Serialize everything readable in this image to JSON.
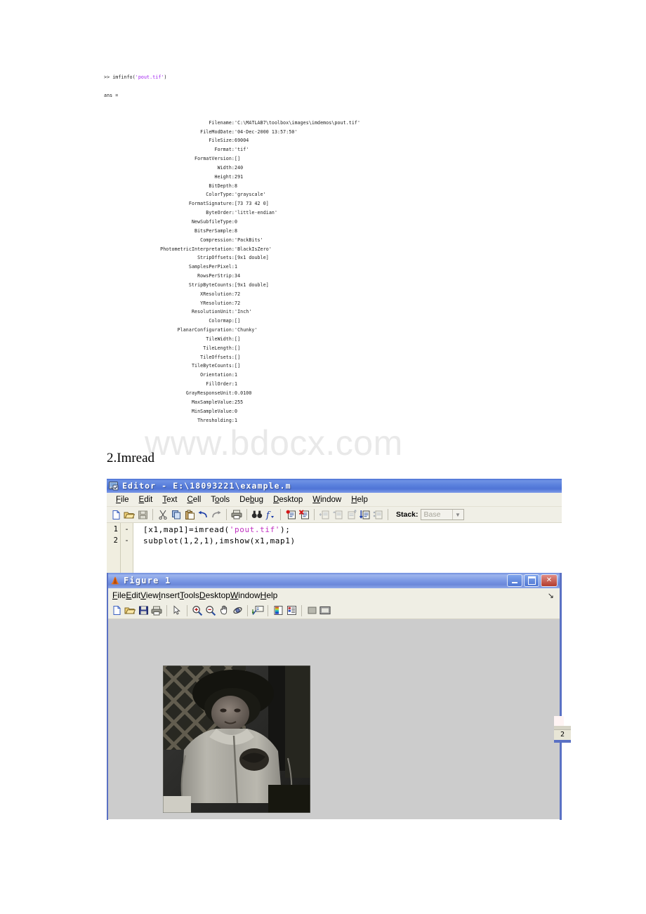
{
  "console": {
    "prompt": ">> ",
    "command_pre": "imfinfo(",
    "command_arg": "'pout.tif'",
    "command_post": ")",
    "ans": "ans =",
    "fields": [
      {
        "name": "Filename:",
        "value": "'C:\\MATLAB7\\toolbox\\images\\imdemos\\pout.tif'"
      },
      {
        "name": "FileModDate:",
        "value": "'04-Dec-2000 13:57:50'"
      },
      {
        "name": "FileSize:",
        "value": "69004"
      },
      {
        "name": "Format:",
        "value": "'tif'"
      },
      {
        "name": "FormatVersion:",
        "value": "[]"
      },
      {
        "name": "Width:",
        "value": "240"
      },
      {
        "name": "Height:",
        "value": "291"
      },
      {
        "name": "BitDepth:",
        "value": "8"
      },
      {
        "name": "ColorType:",
        "value": "'grayscale'"
      },
      {
        "name": "FormatSignature:",
        "value": "[73 73 42 0]"
      },
      {
        "name": "ByteOrder:",
        "value": "'little-endian'"
      },
      {
        "name": "NewSubfileType:",
        "value": "0"
      },
      {
        "name": "BitsPerSample:",
        "value": "8"
      },
      {
        "name": "Compression:",
        "value": "'PackBits'"
      },
      {
        "name": "PhotometricInterpretation:",
        "value": "'BlackIsZero'"
      },
      {
        "name": "StripOffsets:",
        "value": "[9x1 double]"
      },
      {
        "name": "SamplesPerPixel:",
        "value": "1"
      },
      {
        "name": "RowsPerStrip:",
        "value": "34"
      },
      {
        "name": "StripByteCounts:",
        "value": "[9x1 double]"
      },
      {
        "name": "XResolution:",
        "value": "72"
      },
      {
        "name": "YResolution:",
        "value": "72"
      },
      {
        "name": "ResolutionUnit:",
        "value": "'Inch'"
      },
      {
        "name": "Colormap:",
        "value": "[]"
      },
      {
        "name": "PlanarConfiguration:",
        "value": "'Chunky'"
      },
      {
        "name": "TileWidth:",
        "value": "[]"
      },
      {
        "name": "TileLength:",
        "value": "[]"
      },
      {
        "name": "TileOffsets:",
        "value": "[]"
      },
      {
        "name": "TileByteCounts:",
        "value": "[]"
      },
      {
        "name": "Orientation:",
        "value": "1"
      },
      {
        "name": "FillOrder:",
        "value": "1"
      },
      {
        "name": "GrayResponseUnit:",
        "value": "0.0100"
      },
      {
        "name": "MaxSampleValue:",
        "value": "255"
      },
      {
        "name": "MinSampleValue:",
        "value": "0"
      },
      {
        "name": "Thresholding:",
        "value": "1"
      }
    ]
  },
  "watermark": {
    "text": "www.bdocx.com"
  },
  "heading": {
    "text": "2.Imread"
  },
  "editor": {
    "title": "Editor - E:\\18093221\\example.m",
    "title_icon": "matlab-editor-icon",
    "menu": [
      {
        "label": "File",
        "accel": "F"
      },
      {
        "label": "Edit",
        "accel": "E"
      },
      {
        "label": "Text",
        "accel": "T"
      },
      {
        "label": "Cell",
        "accel": "C"
      },
      {
        "label": "Tools",
        "accel": "o"
      },
      {
        "label": "Debug",
        "accel": "b"
      },
      {
        "label": "Desktop",
        "accel": "D"
      },
      {
        "label": "Window",
        "accel": "W"
      },
      {
        "label": "Help",
        "accel": "H"
      }
    ],
    "toolbar_icons": [
      "new-file-icon",
      "open-folder-icon",
      "save-icon",
      "sep",
      "cut-scissors-icon",
      "copy-icon",
      "paste-icon",
      "undo-arrow-icon",
      "redo-arrow-icon",
      "sep",
      "print-icon",
      "sep",
      "find-binoculars-icon",
      "function-browser-icon",
      "sep",
      "set-breakpoint-icon",
      "clear-breakpoints-icon",
      "sep",
      "step-in-icon",
      "step-icon",
      "step-out-icon",
      "continue-icon",
      "exit-debug-icon"
    ],
    "stack_label": "Stack:",
    "stack_value": "Base",
    "code": [
      {
        "num": "1",
        "dash": "-",
        "pre": "[x1,map1]=imread(",
        "str": "'pout.tif'",
        "post": ");"
      },
      {
        "num": "2",
        "dash": "-",
        "pre": "subplot(1,2,1),imshow(x1,map1)",
        "str": "",
        "post": ""
      }
    ]
  },
  "figure": {
    "title": "Figure 1",
    "title_icon": "matlab-membrane-icon",
    "menu": [
      {
        "label": "File",
        "accel": "F"
      },
      {
        "label": "Edit",
        "accel": "E"
      },
      {
        "label": "View",
        "accel": "V"
      },
      {
        "label": "Insert",
        "accel": "I"
      },
      {
        "label": "Tools",
        "accel": "T"
      },
      {
        "label": "Desktop",
        "accel": "D"
      },
      {
        "label": "Window",
        "accel": "W"
      },
      {
        "label": "Help",
        "accel": "H"
      }
    ],
    "overflow_glyph": "↘",
    "toolbar_icons": [
      "new-figure-icon",
      "open-folder-icon",
      "save-icon",
      "print-icon",
      "sep",
      "pointer-arrow-icon",
      "sep",
      "zoom-in-icon",
      "zoom-out-icon",
      "pan-hand-icon",
      "rotate-3d-icon",
      "sep",
      "insert-legend-icon",
      "sep",
      "insert-colorbar-icon",
      "plot-browser-icon",
      "sep",
      "hide-plot-tools-icon",
      "show-plot-tools-icon"
    ],
    "window_buttons": [
      {
        "name": "minimize",
        "glyph": "_"
      },
      {
        "name": "maximize",
        "glyph": "□"
      },
      {
        "name": "close",
        "glyph": "✕"
      }
    ],
    "image_alt": "pout.tif grayscale photo of a child in a jacket"
  },
  "background_window": {
    "cell_text": "2"
  },
  "colors": {
    "titlebar_blue": "#4f74d6",
    "figure_titlebar_blue": "#7d9ae5",
    "toolbar_bg": "#f0efe6",
    "figure_canvas_gray": "#cccccc",
    "code_string_purple": "#c030c0",
    "window_border_blue": "#5a71c4",
    "watermark_gray": "#e9e9e9"
  }
}
